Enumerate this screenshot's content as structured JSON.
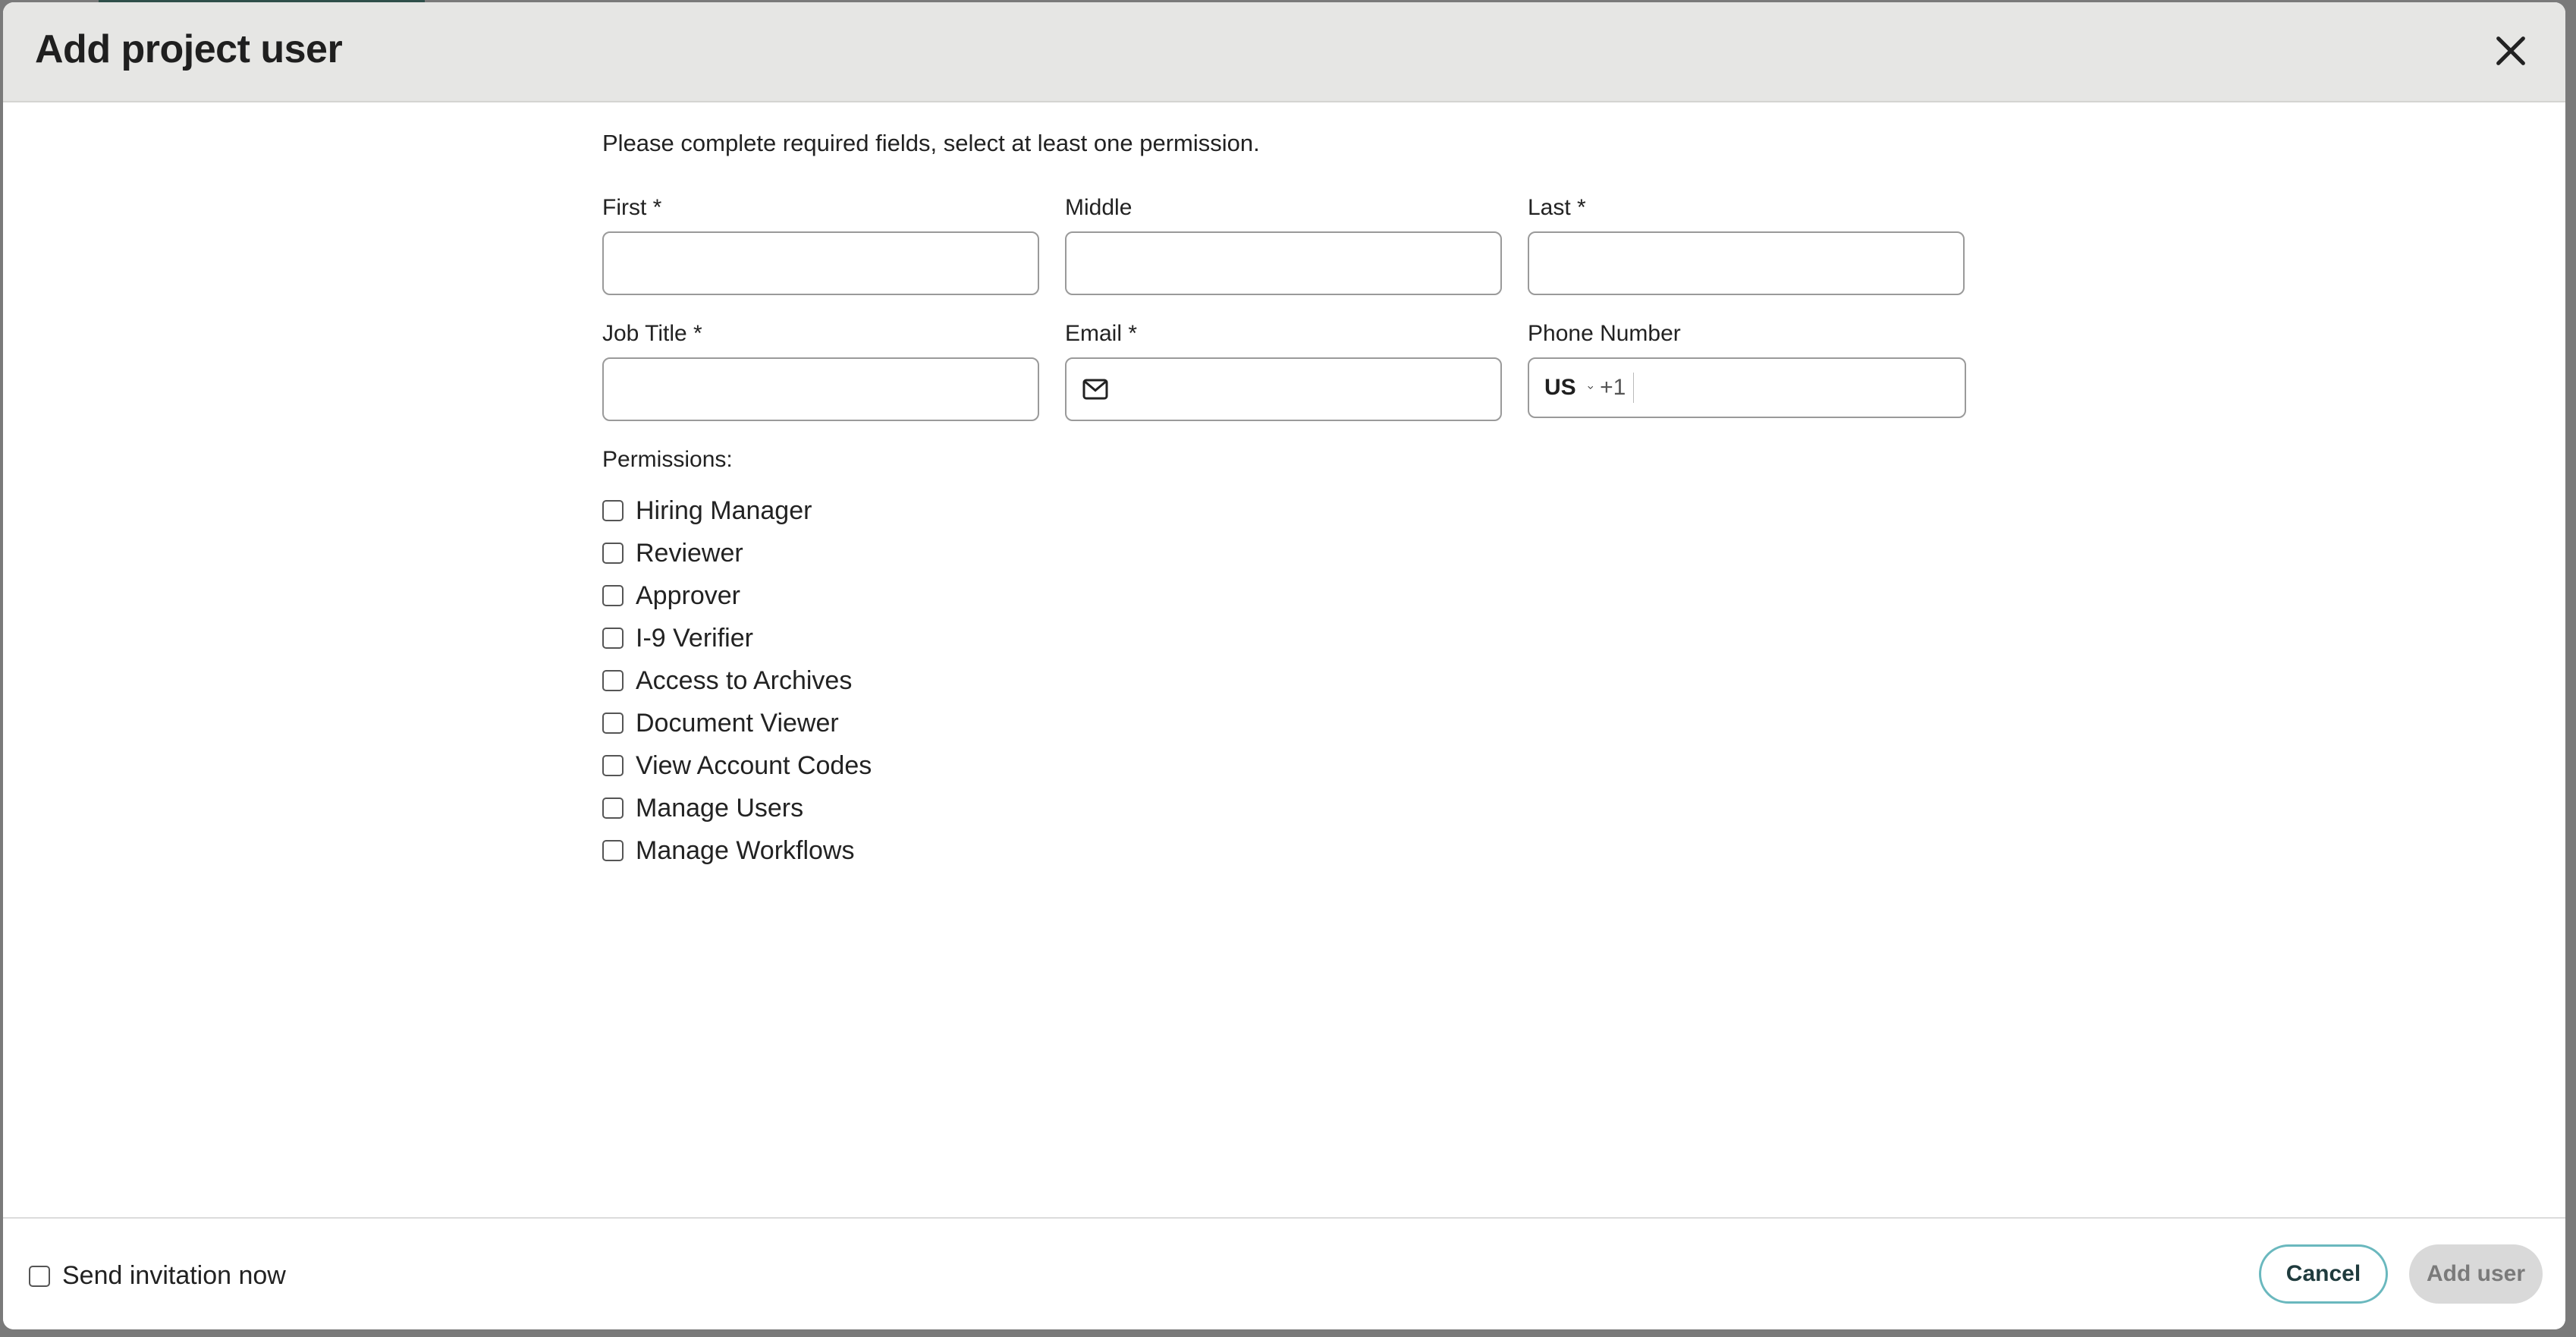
{
  "dialog": {
    "title": "Add project user",
    "instructions": "Please complete required fields, select at least one permission."
  },
  "form": {
    "first_label": "First *",
    "middle_label": "Middle",
    "last_label": "Last *",
    "job_title_label": "Job Title *",
    "email_label": "Email *",
    "phone_label": "Phone Number",
    "phone_country": "US",
    "phone_dial_code": "+1",
    "first_value": "",
    "middle_value": "",
    "last_value": "",
    "job_title_value": "",
    "email_value": "",
    "phone_value": ""
  },
  "permissions": {
    "heading": "Permissions:",
    "items": [
      {
        "label": "Hiring Manager",
        "checked": false
      },
      {
        "label": "Reviewer",
        "checked": false
      },
      {
        "label": "Approver",
        "checked": false
      },
      {
        "label": "I-9 Verifier",
        "checked": false
      },
      {
        "label": "Access to Archives",
        "checked": false
      },
      {
        "label": "Document Viewer",
        "checked": false
      },
      {
        "label": "View Account Codes",
        "checked": false
      },
      {
        "label": "Manage Users",
        "checked": false
      },
      {
        "label": "Manage Workflows",
        "checked": false
      }
    ]
  },
  "footer": {
    "send_invitation_label": "Send invitation now",
    "cancel_label": "Cancel",
    "add_user_label": "Add user"
  },
  "colors": {
    "header_bg": "#e6e6e4",
    "cancel_border": "#6ab8be",
    "add_disabled_bg": "#d9d9d9"
  },
  "icons": {
    "close": "close-icon",
    "email": "mail-icon",
    "country_dropdown": "chevron-down-icon"
  }
}
